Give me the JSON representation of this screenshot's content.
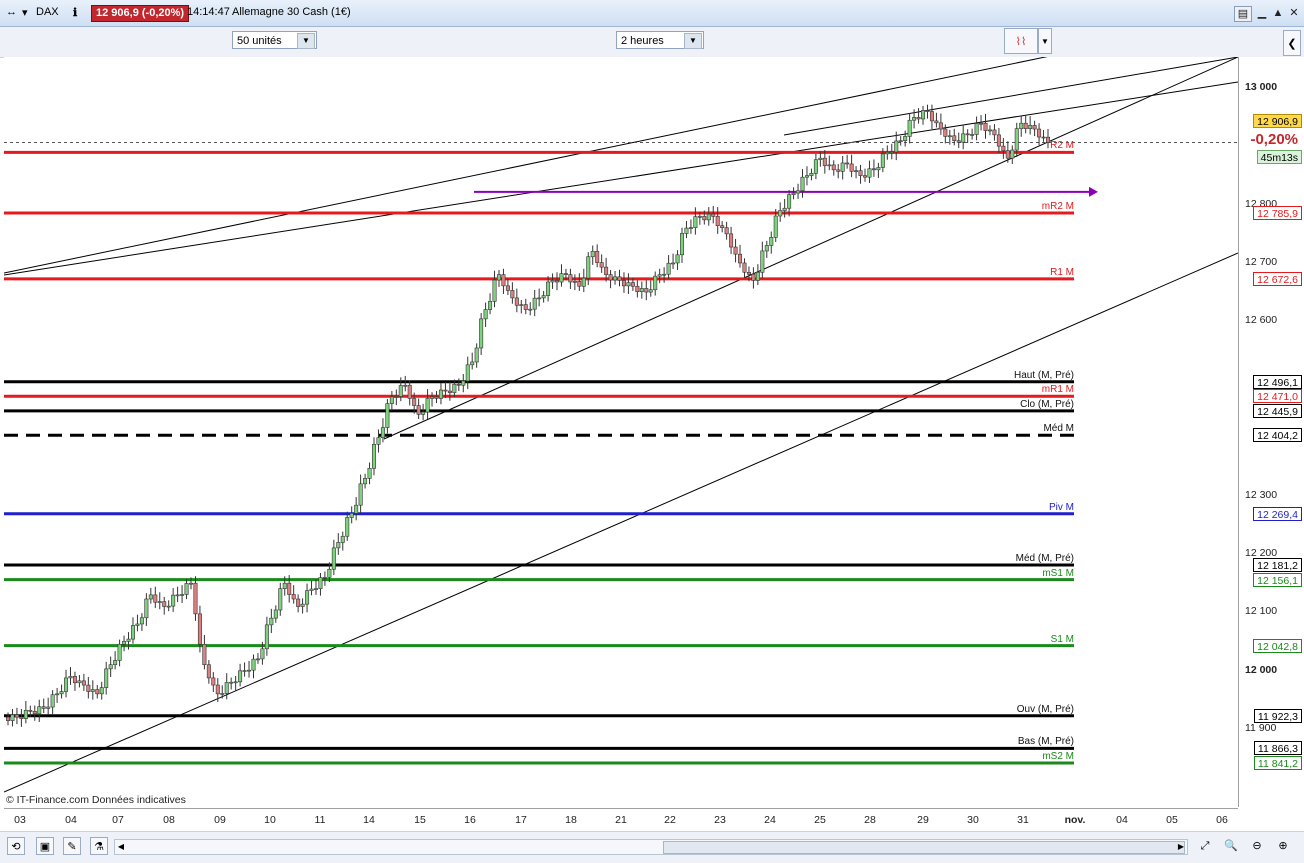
{
  "window": {
    "symbol": "DAX",
    "price_badge": "12 906,9 (-0,20%)",
    "time": "14:14:47",
    "instrument": "Allemagne 30 Cash (1€)"
  },
  "toolbar": {
    "units_select": "50 unités",
    "period_select": "2 heures"
  },
  "chart": {
    "watermark": "© IT-Finance.com  Données indicatives",
    "price_tag": "12 906,9",
    "change_tag": "-0,20%",
    "timer_tag": "45m13s",
    "y_ticks": [
      "13 000",
      "12 800",
      "12 700",
      "12 600",
      "12 300",
      "12 200",
      "12 100",
      "12 000",
      "11 900"
    ],
    "x_ticks": [
      "03",
      "04",
      "07",
      "08",
      "09",
      "10",
      "11",
      "14",
      "15",
      "16",
      "17",
      "18",
      "21",
      "22",
      "23",
      "24",
      "25",
      "28",
      "29",
      "30",
      "31",
      "nov.",
      "04",
      "05",
      "06"
    ],
    "levels": [
      {
        "name": "R2 M",
        "value": "12 890,?",
        "tag": "",
        "color": "#e41a1c",
        "style": "solid"
      },
      {
        "name": "mR2 M",
        "tag": "12 785,9",
        "color": "#e41a1c",
        "style": "solid"
      },
      {
        "name": "R1 M",
        "tag": "12 672,6",
        "color": "#e41a1c",
        "style": "solid"
      },
      {
        "name": "Haut (M, Pré)",
        "tag": "12 496,1",
        "color": "#000000",
        "style": "solid"
      },
      {
        "name": "mR1 M",
        "tag": "12 471,0",
        "color": "#e41a1c",
        "style": "solid"
      },
      {
        "name": "Clo (M, Pré)",
        "tag": "12 445,9",
        "color": "#000000",
        "style": "solid"
      },
      {
        "name": "Méd M",
        "tag": "12 404,2",
        "color": "#000000",
        "style": "dashed"
      },
      {
        "name": "Piv M",
        "tag": "12 269,4",
        "color": "#1f1fcc",
        "style": "solid"
      },
      {
        "name": "Méd (M, Pré)",
        "tag": "12 181,2",
        "color": "#000000",
        "style": "solid"
      },
      {
        "name": "mS1 M",
        "tag": "12 156,1",
        "color": "#1a8a1a",
        "style": "solid"
      },
      {
        "name": "S1 M",
        "tag": "12 042,8",
        "color": "#1a8a1a",
        "style": "solid"
      },
      {
        "name": "Ouv (M, Pré)",
        "tag": "11 922,3",
        "color": "#000000",
        "style": "solid"
      },
      {
        "name": "Bas (M, Pré)",
        "tag": "11 866,3",
        "color": "#000000",
        "style": "solid"
      },
      {
        "name": "mS2 M",
        "tag": "11 841,2",
        "color": "#1a8a1a",
        "style": "solid"
      }
    ]
  },
  "chart_data": {
    "type": "candlestick",
    "title": "",
    "ylim": [
      11800,
      13040
    ],
    "x_labels": [
      "03",
      "04",
      "07",
      "08",
      "09",
      "10",
      "11",
      "14",
      "15",
      "16",
      "17",
      "18",
      "21",
      "22",
      "23",
      "24",
      "25",
      "28",
      "29",
      "30",
      "31",
      "nov.",
      "04",
      "05",
      "06"
    ],
    "close_path": [
      11920,
      11930,
      11935,
      11960,
      11990,
      11975,
      11960,
      12010,
      12050,
      12080,
      12130,
      12110,
      12130,
      12150,
      12010,
      11960,
      11980,
      12000,
      12020,
      12090,
      12150,
      12110,
      12140,
      12160,
      12220,
      12270,
      12330,
      12400,
      12470,
      12490,
      12440,
      12470,
      12480,
      12490,
      12530,
      12620,
      12680,
      12640,
      12620,
      12640,
      12670,
      12680,
      12660,
      12720,
      12680,
      12670,
      12660,
      12650,
      12680,
      12700,
      12760,
      12780,
      12780,
      12750,
      12700,
      12670,
      12730,
      12790,
      12820,
      12850,
      12880,
      12860,
      12870,
      12850,
      12860,
      12890,
      12910,
      12950,
      12960,
      12930,
      12910,
      12920,
      12940,
      12920,
      12880,
      12940,
      12930,
      12906.9
    ]
  },
  "colors": {
    "up": "#7fd17f",
    "down": "#d98080",
    "trend": "#000000",
    "purple_line": "#8e00b8"
  }
}
